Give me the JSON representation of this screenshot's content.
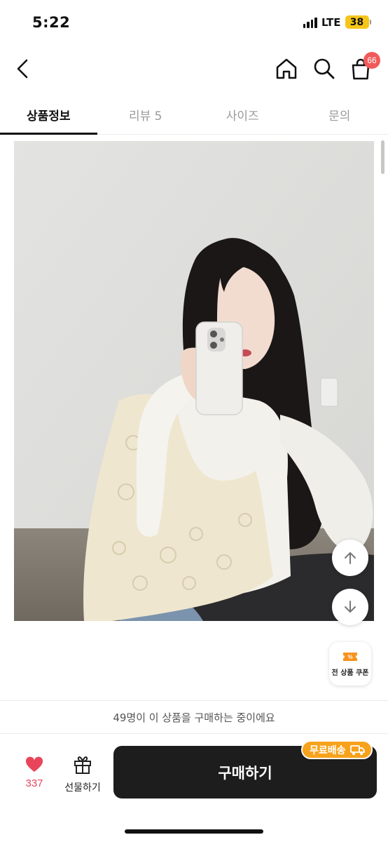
{
  "status_bar": {
    "time": "5:22",
    "network": "LTE",
    "battery": "38"
  },
  "nav": {
    "cart_count": "66"
  },
  "tabs": [
    {
      "label": "상품정보",
      "active": true
    },
    {
      "label": "리뷰 5",
      "active": false
    },
    {
      "label": "사이즈",
      "active": false
    },
    {
      "label": "문의",
      "active": false
    }
  ],
  "floating": {
    "coupon_label": "전 상품 쿠폰"
  },
  "viewer_notice": "49명이 이 상품을 구매하는 중이에요",
  "bottom_bar": {
    "like_count": "337",
    "gift_label": "선물하기",
    "buy_label": "구매하기",
    "shipping_badge": "무료배송"
  },
  "colors": {
    "accent": "#f7a21b",
    "like": "#e8455d",
    "buy_button": "#1d1d1d",
    "badge": "#f05a5a"
  }
}
